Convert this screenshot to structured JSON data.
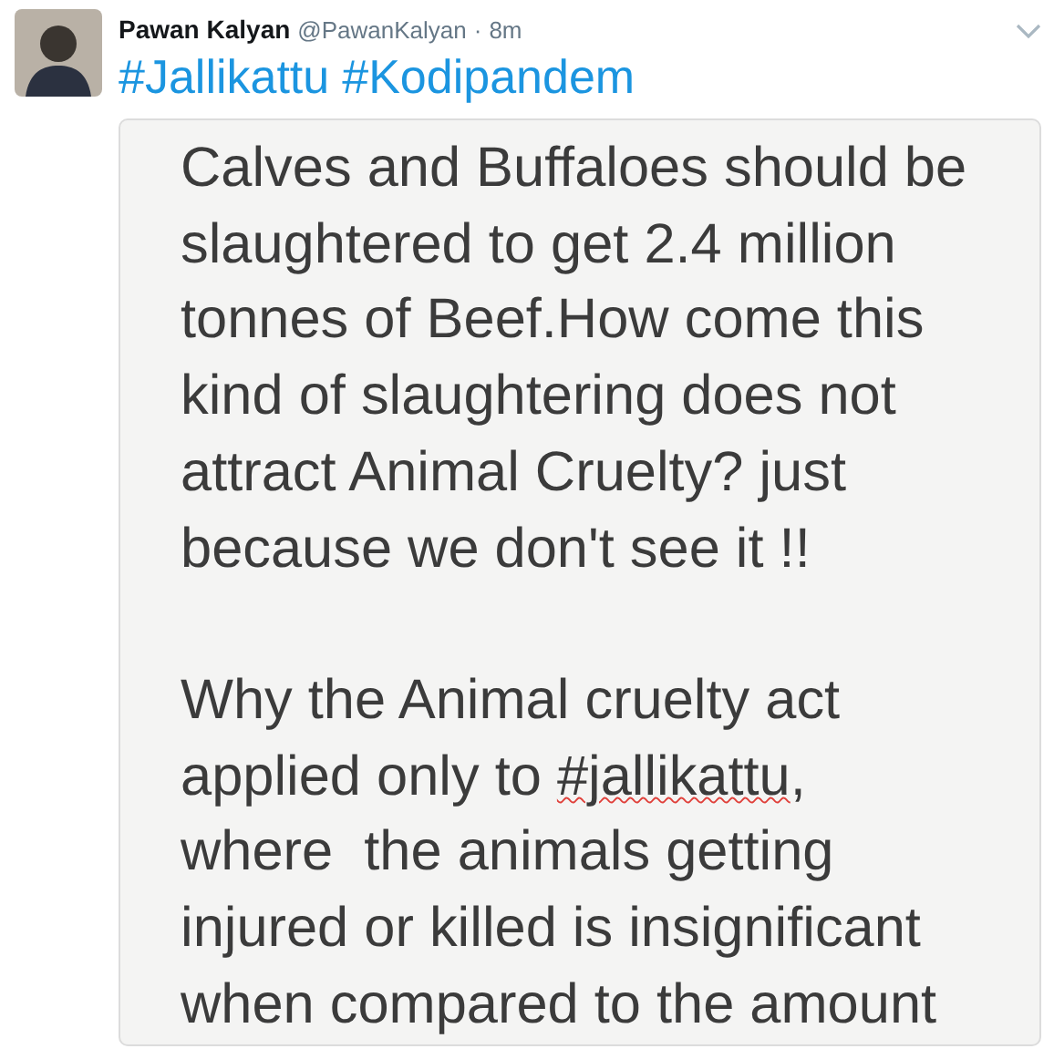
{
  "tweet": {
    "author_name": "Pawan Kalyan",
    "handle": "@PawanKalyan",
    "separator": "·",
    "time": "8m",
    "hashtags": [
      "#Jallikattu",
      "#Kodipandem"
    ],
    "note_image": {
      "paragraphs": [
        {
          "lines": [
            [
              {
                "text": "Calves and Buffaloes should be"
              }
            ],
            [
              {
                "text": "slaughtered to get 2.4 million"
              }
            ],
            [
              {
                "text": "tonnes of Beef.How come this"
              }
            ],
            [
              {
                "text": "kind of slaughtering does not"
              }
            ],
            [
              {
                "text": "attract Animal Cruelty? just"
              }
            ],
            [
              {
                "text": "because we don't see it !!"
              }
            ]
          ]
        },
        {
          "lines": [
            [
              {
                "text": "Why the Animal cruelty act"
              }
            ],
            [
              {
                "text": "applied only to "
              },
              {
                "text": "#jallikattu",
                "misspelled": true
              },
              {
                "text": ","
              }
            ],
            [
              {
                "text": "where  the animals getting"
              }
            ],
            [
              {
                "text": "injured or killed is insignificant"
              }
            ],
            [
              {
                "text": "when compared to the amount"
              }
            ]
          ]
        }
      ]
    }
  }
}
